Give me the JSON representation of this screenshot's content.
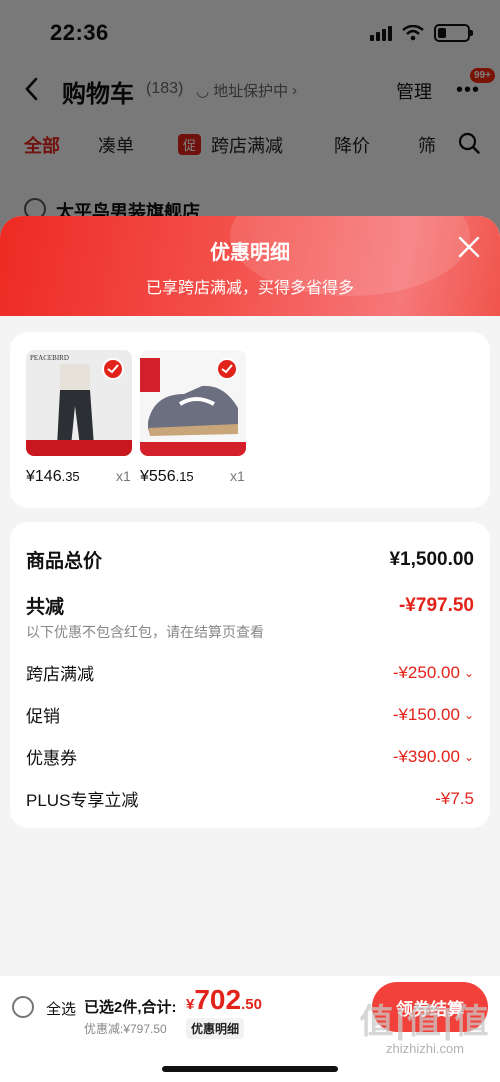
{
  "status_bar": {
    "time": "22:36",
    "battery_level": 0.3
  },
  "nav": {
    "title": "购物车",
    "count": "(183)",
    "address_tag": "地址保护中",
    "manage": "管理",
    "badge": "99+"
  },
  "tabs": [
    {
      "label": "全部",
      "active": true
    },
    {
      "label": "凑单"
    },
    {
      "label": "跨店满减",
      "chip": "促"
    },
    {
      "label": "降价"
    },
    {
      "label": "筛"
    }
  ],
  "store": {
    "name": "太平鸟男装旗舰店"
  },
  "sheet": {
    "title": "优惠明细",
    "subtitle": "已享跨店满减，买得多省得多"
  },
  "products": [
    {
      "price_int": "¥146",
      "price_dec": ".35",
      "qty": "x1",
      "brand": "PEACEBIRD"
    },
    {
      "price_int": "¥556",
      "price_dec": ".15",
      "qty": "x1"
    }
  ],
  "details": {
    "goods_total_label": "商品总价",
    "goods_total_value": "¥1,500.00",
    "total_off_label": "共减",
    "total_off_value": "-¥797.50",
    "note": "以下优惠不包含红包，请在结算页查看",
    "items": [
      {
        "label": "跨店满减",
        "value": "-¥250.00"
      },
      {
        "label": "促销",
        "value": "-¥150.00"
      },
      {
        "label": "优惠券",
        "value": "-¥390.00"
      },
      {
        "label": "PLUS专享立减",
        "value": "-¥7.5"
      }
    ]
  },
  "bottom": {
    "select_all": "全选",
    "selected": "已选2件,合计:",
    "price_yen": "¥",
    "price_int": "702",
    "price_dec": ".50",
    "discount": "优惠减:¥797.50",
    "detail_btn": "优惠明细",
    "checkout": "领券结算",
    "watermark_logo": "值|值|值",
    "watermark_url": "zhizhizhi.com"
  },
  "colors": {
    "accent": "#e2231a",
    "header_gradient_start": "#ee2a24",
    "header_gradient_end": "#f6787a"
  }
}
